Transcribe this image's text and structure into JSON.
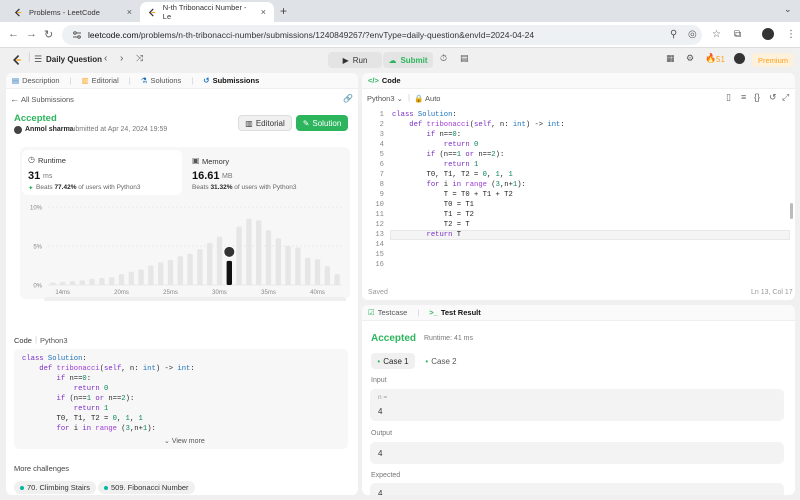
{
  "browser": {
    "tabs": [
      {
        "title": "Problems - LeetCode",
        "active": false
      },
      {
        "title": "N-th Tribonacci Number - Le",
        "active": true
      }
    ],
    "url_host": "leetcode.com",
    "url_path": "/problems/n-th-tribonacci-number/submissions/1240849267/?envType=daily-question&envId=2024-04-24"
  },
  "topbar": {
    "daily_label": "Daily Question",
    "run_label": "Run",
    "submit_label": "Submit",
    "streak_count": "51",
    "premium_label": "Premium"
  },
  "left": {
    "tabs": [
      "Description",
      "Editorial",
      "Solutions",
      "Submissions"
    ],
    "all_submissions": "All Submissions",
    "status": "Accepted",
    "user": "Anmol sharma",
    "submitted_text": "submitted at Apr 24, 2024 19:59",
    "editorial_btn": "Editorial",
    "solution_btn": "Solution",
    "runtime": {
      "label": "Runtime",
      "value": "31",
      "unit": "ms",
      "beats_prefix": "Beats",
      "beats_pct": "77.42%",
      "beats_suffix": "of users with Python3"
    },
    "memory": {
      "label": "Memory",
      "value": "16.61",
      "unit": "MB",
      "beats_prefix": "Beats",
      "beats_pct": "31.32%",
      "beats_suffix": "of users with Python3"
    },
    "code_label": "Code",
    "code_lang": "Python3",
    "view_more": "View more",
    "more_challenges": "More challenges",
    "challenges": [
      "70. Climbing Stairs",
      "509. Fibonacci Number"
    ]
  },
  "chart_data": {
    "type": "bar",
    "ylabel_ticks": [
      "10%",
      "5%",
      "0%"
    ],
    "ylim": [
      0,
      10
    ],
    "x_ticks": [
      "14ms",
      "20ms",
      "25ms",
      "30ms",
      "35ms",
      "40ms"
    ],
    "x_tick_values": [
      14,
      20,
      25,
      30,
      35,
      40
    ],
    "bars_x": [
      13,
      14,
      15,
      16,
      17,
      18,
      19,
      20,
      21,
      22,
      23,
      24,
      25,
      26,
      27,
      28,
      29,
      30,
      31,
      32,
      33,
      34,
      35,
      36,
      37,
      38,
      39,
      40,
      41,
      42
    ],
    "bars_y": [
      0.3,
      0.4,
      0.5,
      0.6,
      0.8,
      0.9,
      1.0,
      1.4,
      1.7,
      2.0,
      2.5,
      2.9,
      3.2,
      3.7,
      4.0,
      4.6,
      5.4,
      6.2,
      3.1,
      7.5,
      8.5,
      8.3,
      7.0,
      6.0,
      5.0,
      4.8,
      3.5,
      3.3,
      2.4,
      1.4
    ],
    "highlight_x": 31,
    "highlight_y": 3.1,
    "colors": {
      "bar": "#e6e6e6",
      "highlight": "#111111"
    }
  },
  "editor": {
    "title": "Code",
    "language": "Python3",
    "auto_label": "Auto",
    "saved_label": "Saved",
    "cursor_pos": "Ln 13, Col 17"
  },
  "test": {
    "tabs": [
      "Testcase",
      "Test Result"
    ],
    "status": "Accepted",
    "runtime_text": "Runtime: 41 ms",
    "cases": [
      "Case 1",
      "Case 2"
    ],
    "input_label": "Input",
    "input_var": "n =",
    "input_value": "4",
    "output_label": "Output",
    "output_value": "4",
    "expected_label": "Expected",
    "expected_value": "4"
  },
  "colors": {
    "accent_green": "#2db55d",
    "leetcode_orange": "#ffa116",
    "teal": "#00b8a3"
  }
}
